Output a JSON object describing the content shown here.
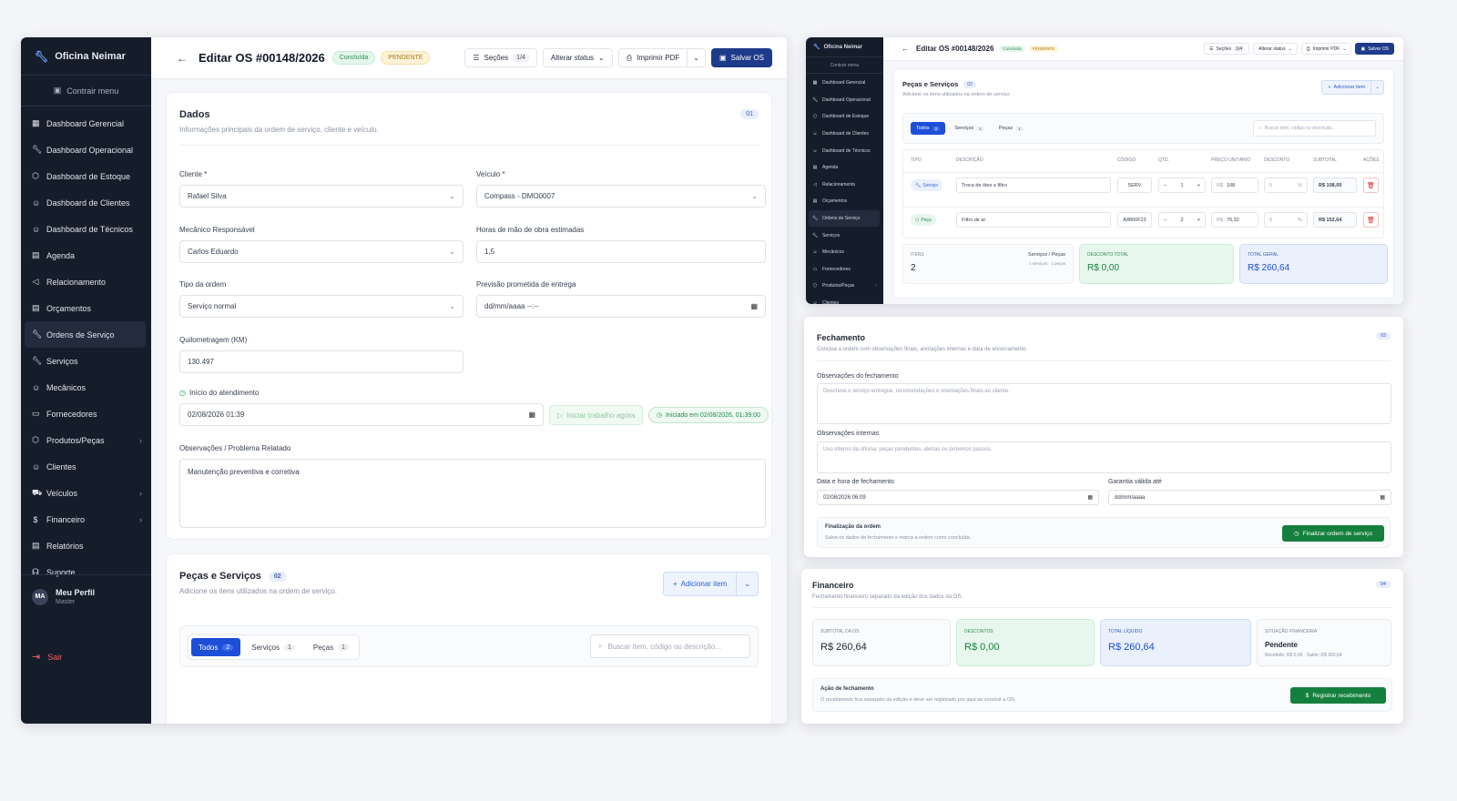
{
  "brand": "Oficina Neimar",
  "collapse_label": "Contrair menu",
  "sidebar": [
    {
      "label": "Dashboard Gerencial",
      "icon": "grid-icon"
    },
    {
      "label": "Dashboard Operacional",
      "icon": "wrench-icon"
    },
    {
      "label": "Dashboard de Estoque",
      "icon": "boxes-icon"
    },
    {
      "label": "Dashboard de Clientes",
      "icon": "users-icon"
    },
    {
      "label": "Dashboard de Técnicos",
      "icon": "user-cog-icon"
    },
    {
      "label": "Agenda",
      "icon": "calendar-icon"
    },
    {
      "label": "Relacionamento",
      "icon": "megaphone-icon"
    },
    {
      "label": "Orçamentos",
      "icon": "file-icon"
    },
    {
      "label": "Ordens de Serviço",
      "icon": "wrench-icon",
      "active": true
    },
    {
      "label": "Serviços",
      "icon": "wrench-icon"
    },
    {
      "label": "Mecânicos",
      "icon": "user-icon"
    },
    {
      "label": "Fornecedores",
      "icon": "truck-icon"
    },
    {
      "label": "Produtos/Peças",
      "icon": "package-icon",
      "chevron": true
    },
    {
      "label": "Clientes",
      "icon": "users-icon"
    },
    {
      "label": "Veículos",
      "icon": "car-icon",
      "chevron": true
    },
    {
      "label": "Financeiro",
      "icon": "dollar-icon",
      "chevron": true
    },
    {
      "label": "Relatórios",
      "icon": "report-icon"
    },
    {
      "label": "Suporte",
      "icon": "headset-icon"
    }
  ],
  "profile": {
    "initials": "MA",
    "name": "Meu Perfil",
    "role": "Master"
  },
  "logout": "Sair",
  "header": {
    "title": "Editar OS #00148/2026",
    "status_badge": "Concluída",
    "payment_badge": "PENDENTE",
    "sections_label": "Seções",
    "sections_count": "1/4",
    "change_status": "Alterar status",
    "print_pdf": "Imprimir PDF",
    "save": "Salvar OS"
  },
  "dados": {
    "title": "Dados",
    "number": "01",
    "subtitle": "Informações principais da ordem de serviço, cliente e veículo.",
    "cliente_label": "Cliente *",
    "cliente": "Rafael Silva",
    "veiculo_label": "Veículo *",
    "veiculo": "Compass - DMO0007",
    "mecanico_label": "Mecânico Responsável",
    "mecanico": "Carlos Eduardo",
    "horas_label": "Horas de mão de obra estimadas",
    "horas": "1,5",
    "tipo_label": "Tipo da ordem",
    "tipo": "Serviço normal",
    "previsao_label": "Previsão prometida de entrega",
    "previsao": "dd/mm/aaaa --:--",
    "km_label": "Quilometragem (KM)",
    "km": "130.497",
    "inicio_label": "Início do atendimento",
    "inicio": "02/08/2026 01:39",
    "iniciar_btn": "Iniciar trabalho agora",
    "iniciado": "Iniciado em 02/08/2026, 01:39:00",
    "obs_label": "Observações / Problema Relatado",
    "obs": "Manutenção preventiva e corretiva"
  },
  "pecas": {
    "title": "Peças e Serviços",
    "number": "02",
    "subtitle": "Adicione os itens utilizados na ordem de serviço.",
    "add_btn": "Adicionar item",
    "tabs": [
      {
        "label": "Todos",
        "count": "2"
      },
      {
        "label": "Serviços",
        "count": "1"
      },
      {
        "label": "Peças",
        "count": "1"
      }
    ],
    "search_placeholder": "Buscar item, código ou descrição...",
    "columns": [
      "Tipo",
      "Descrição",
      "Código",
      "Qtd.",
      "Preço unitário",
      "Desconto",
      "Subtotal",
      "Ações"
    ],
    "rows": [
      {
        "tipo": "Serviço",
        "descricao": "Troca de óleo e filtro",
        "codigo": "SERV",
        "qtd": "1",
        "preco": "108",
        "desconto": "0",
        "subtotal": "R$ 108,00"
      },
      {
        "tipo": "Peça",
        "descricao": "Filtro de ar",
        "codigo": "A8800F23",
        "qtd": "2",
        "preco": "76,32",
        "desconto": "0",
        "subtotal": "R$ 152,64"
      }
    ],
    "currency": "R$",
    "percent": "%",
    "itens_label": "Itens",
    "itens": "2",
    "itens_type_label": "Serviços / Peças",
    "itens_type_detail": "1 serviços · 1 peças",
    "desconto_label": "Desconto total",
    "desconto": "R$ 0,00",
    "total_label": "Total geral",
    "total": "R$ 260,64"
  },
  "fechamento": {
    "title": "Fechamento",
    "number": "03",
    "subtitle": "Conclua a ordem com observações finais, anotações internas e data de encerramento.",
    "obs_label": "Observações do fechamento",
    "obs_placeholder": "Descreva o serviço entregue, recomendações e orientações finais ao cliente.",
    "internas_label": "Observações internas",
    "internas_placeholder": "Uso interno da oficina: peças pendentes, alertas ou próximos passos.",
    "data_label": "Data e hora de fechamento",
    "data": "02/08/2026 06:09",
    "garantia_label": "Garantia válida até",
    "garantia": "dd/mm/aaaa",
    "final_title": "Finalização da ordem",
    "final_sub": "Salva os dados de fechamento e marca a ordem como concluída.",
    "final_btn": "Finalizar ordem de serviço"
  },
  "financeiro": {
    "title": "Financeiro",
    "number": "04",
    "subtitle": "Fechamento financeiro separado da edição dos dados da OS.",
    "subtotal_label": "Subtotal da OS",
    "subtotal": "R$ 260,64",
    "descontos_label": "Descontos",
    "descontos": "R$ 0,00",
    "liquido_label": "Total líquido",
    "liquido": "R$ 260,64",
    "situacao_label": "Situação financeira",
    "situacao": "Pendente",
    "situacao_detail": "Recebido: R$ 0,00 · Saldo: R$ 260,64",
    "acao_title": "Ação de fechamento",
    "acao_sub": "O recebimento fica separado da edição e deve ser registrado por aqui ao concluir a OS.",
    "acao_btn": "Registrar recebimento"
  },
  "colors": {
    "sidebar": "#151c2a",
    "primary": "#1e3a8a",
    "accent": "#1d4ed8",
    "success": "#15803d"
  }
}
